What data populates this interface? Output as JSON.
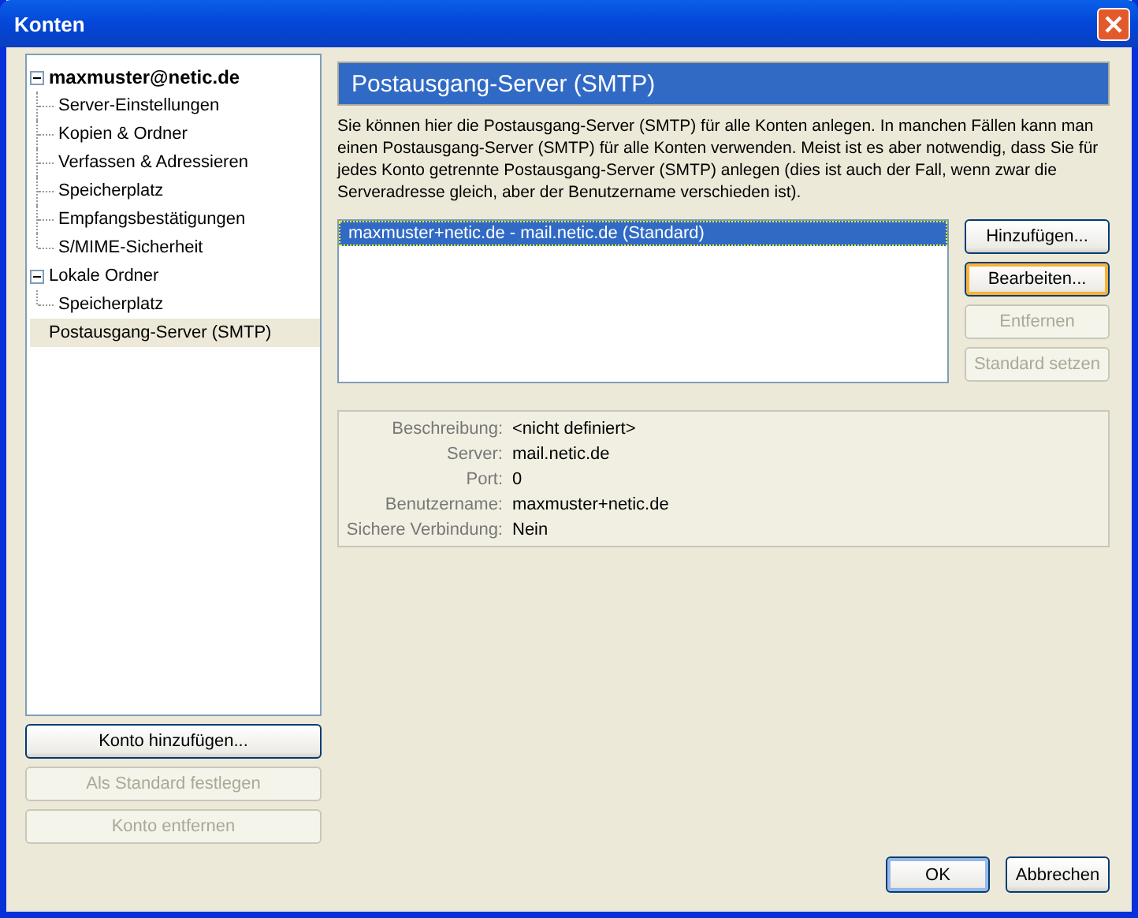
{
  "window": {
    "title": "Konten"
  },
  "tree": [
    {
      "label": "maxmuster@netic.de",
      "bold": true,
      "expanded": true,
      "selected": false,
      "children": [
        {
          "label": "Server-Einstellungen",
          "selected": false
        },
        {
          "label": "Kopien & Ordner",
          "selected": false
        },
        {
          "label": "Verfassen & Adressieren",
          "selected": false
        },
        {
          "label": "Speicherplatz",
          "selected": false
        },
        {
          "label": "Empfangsbestätigungen",
          "selected": false
        },
        {
          "label": "S/MIME-Sicherheit",
          "selected": false
        }
      ]
    },
    {
      "label": "Lokale Ordner",
      "bold": false,
      "expanded": true,
      "selected": false,
      "children": [
        {
          "label": "Speicherplatz",
          "selected": false
        }
      ]
    },
    {
      "label": "Postausgang-Server (SMTP)",
      "bold": false,
      "selected": true
    }
  ],
  "account_buttons": [
    {
      "label": "Konto hinzufügen...",
      "disabled": false
    },
    {
      "label": "Als Standard festlegen",
      "disabled": true
    },
    {
      "label": "Konto entfernen",
      "disabled": true
    }
  ],
  "panel": {
    "title": "Postausgang-Server (SMTP)",
    "description": "Sie können hier die Postausgang-Server (SMTP) für alle Konten anlegen. In manchen Fällen kann man einen Postausgang-Server (SMTP) für alle Konten verwenden. Meist ist es aber notwendig, dass Sie für jedes Konto getrennte Postausgang-Server (SMTP) anlegen (dies ist auch der Fall, wenn zwar die Serveradresse gleich, aber der Benutzername verschieden ist).",
    "servers": [
      {
        "label": "maxmuster+netic.de - mail.netic.de (Standard)",
        "selected": true
      }
    ],
    "server_buttons": [
      {
        "label": "Hinzufügen...",
        "disabled": false
      },
      {
        "label": "Bearbeiten...",
        "disabled": false
      },
      {
        "label": "Entfernen",
        "disabled": true
      },
      {
        "label": "Standard setzen",
        "disabled": true
      }
    ],
    "details": [
      {
        "label": "Beschreibung:",
        "value": "<nicht definiert>"
      },
      {
        "label": "Server:",
        "value": "mail.netic.de"
      },
      {
        "label": "Port:",
        "value": "0"
      },
      {
        "label": "Benutzername:",
        "value": "maxmuster+netic.de"
      },
      {
        "label": "Sichere Verbindung:",
        "value": "Nein"
      }
    ]
  },
  "dialog_buttons": [
    {
      "label": "OK",
      "disabled": false
    },
    {
      "label": "Abbrechen",
      "disabled": false
    }
  ]
}
